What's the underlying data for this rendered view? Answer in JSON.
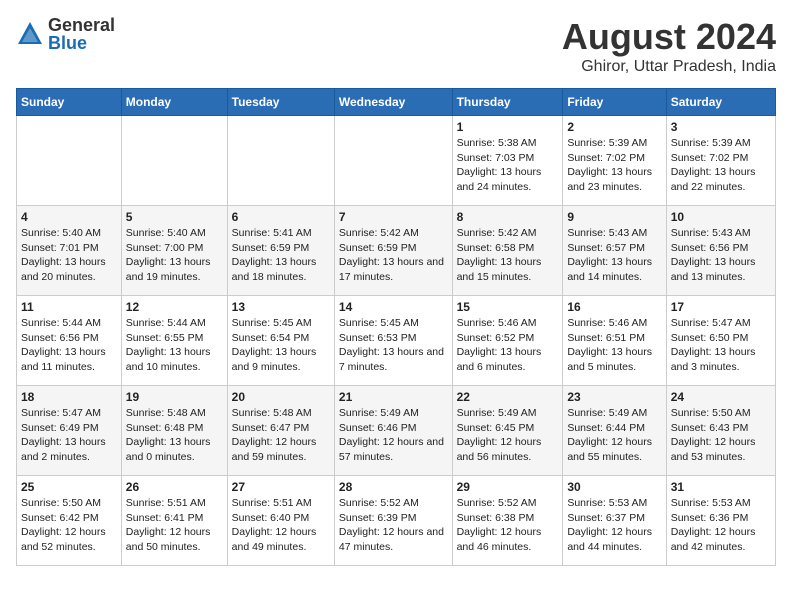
{
  "logo": {
    "general": "General",
    "blue": "Blue"
  },
  "title": "August 2024",
  "subtitle": "Ghiror, Uttar Pradesh, India",
  "days_of_week": [
    "Sunday",
    "Monday",
    "Tuesday",
    "Wednesday",
    "Thursday",
    "Friday",
    "Saturday"
  ],
  "weeks": [
    [
      {
        "day": "",
        "info": ""
      },
      {
        "day": "",
        "info": ""
      },
      {
        "day": "",
        "info": ""
      },
      {
        "day": "",
        "info": ""
      },
      {
        "day": "1",
        "info": "Sunrise: 5:38 AM\nSunset: 7:03 PM\nDaylight: 13 hours and 24 minutes."
      },
      {
        "day": "2",
        "info": "Sunrise: 5:39 AM\nSunset: 7:02 PM\nDaylight: 13 hours and 23 minutes."
      },
      {
        "day": "3",
        "info": "Sunrise: 5:39 AM\nSunset: 7:02 PM\nDaylight: 13 hours and 22 minutes."
      }
    ],
    [
      {
        "day": "4",
        "info": "Sunrise: 5:40 AM\nSunset: 7:01 PM\nDaylight: 13 hours and 20 minutes."
      },
      {
        "day": "5",
        "info": "Sunrise: 5:40 AM\nSunset: 7:00 PM\nDaylight: 13 hours and 19 minutes."
      },
      {
        "day": "6",
        "info": "Sunrise: 5:41 AM\nSunset: 6:59 PM\nDaylight: 13 hours and 18 minutes."
      },
      {
        "day": "7",
        "info": "Sunrise: 5:42 AM\nSunset: 6:59 PM\nDaylight: 13 hours and 17 minutes."
      },
      {
        "day": "8",
        "info": "Sunrise: 5:42 AM\nSunset: 6:58 PM\nDaylight: 13 hours and 15 minutes."
      },
      {
        "day": "9",
        "info": "Sunrise: 5:43 AM\nSunset: 6:57 PM\nDaylight: 13 hours and 14 minutes."
      },
      {
        "day": "10",
        "info": "Sunrise: 5:43 AM\nSunset: 6:56 PM\nDaylight: 13 hours and 13 minutes."
      }
    ],
    [
      {
        "day": "11",
        "info": "Sunrise: 5:44 AM\nSunset: 6:56 PM\nDaylight: 13 hours and 11 minutes."
      },
      {
        "day": "12",
        "info": "Sunrise: 5:44 AM\nSunset: 6:55 PM\nDaylight: 13 hours and 10 minutes."
      },
      {
        "day": "13",
        "info": "Sunrise: 5:45 AM\nSunset: 6:54 PM\nDaylight: 13 hours and 9 minutes."
      },
      {
        "day": "14",
        "info": "Sunrise: 5:45 AM\nSunset: 6:53 PM\nDaylight: 13 hours and 7 minutes."
      },
      {
        "day": "15",
        "info": "Sunrise: 5:46 AM\nSunset: 6:52 PM\nDaylight: 13 hours and 6 minutes."
      },
      {
        "day": "16",
        "info": "Sunrise: 5:46 AM\nSunset: 6:51 PM\nDaylight: 13 hours and 5 minutes."
      },
      {
        "day": "17",
        "info": "Sunrise: 5:47 AM\nSunset: 6:50 PM\nDaylight: 13 hours and 3 minutes."
      }
    ],
    [
      {
        "day": "18",
        "info": "Sunrise: 5:47 AM\nSunset: 6:49 PM\nDaylight: 13 hours and 2 minutes."
      },
      {
        "day": "19",
        "info": "Sunrise: 5:48 AM\nSunset: 6:48 PM\nDaylight: 13 hours and 0 minutes."
      },
      {
        "day": "20",
        "info": "Sunrise: 5:48 AM\nSunset: 6:47 PM\nDaylight: 12 hours and 59 minutes."
      },
      {
        "day": "21",
        "info": "Sunrise: 5:49 AM\nSunset: 6:46 PM\nDaylight: 12 hours and 57 minutes."
      },
      {
        "day": "22",
        "info": "Sunrise: 5:49 AM\nSunset: 6:45 PM\nDaylight: 12 hours and 56 minutes."
      },
      {
        "day": "23",
        "info": "Sunrise: 5:49 AM\nSunset: 6:44 PM\nDaylight: 12 hours and 55 minutes."
      },
      {
        "day": "24",
        "info": "Sunrise: 5:50 AM\nSunset: 6:43 PM\nDaylight: 12 hours and 53 minutes."
      }
    ],
    [
      {
        "day": "25",
        "info": "Sunrise: 5:50 AM\nSunset: 6:42 PM\nDaylight: 12 hours and 52 minutes."
      },
      {
        "day": "26",
        "info": "Sunrise: 5:51 AM\nSunset: 6:41 PM\nDaylight: 12 hours and 50 minutes."
      },
      {
        "day": "27",
        "info": "Sunrise: 5:51 AM\nSunset: 6:40 PM\nDaylight: 12 hours and 49 minutes."
      },
      {
        "day": "28",
        "info": "Sunrise: 5:52 AM\nSunset: 6:39 PM\nDaylight: 12 hours and 47 minutes."
      },
      {
        "day": "29",
        "info": "Sunrise: 5:52 AM\nSunset: 6:38 PM\nDaylight: 12 hours and 46 minutes."
      },
      {
        "day": "30",
        "info": "Sunrise: 5:53 AM\nSunset: 6:37 PM\nDaylight: 12 hours and 44 minutes."
      },
      {
        "day": "31",
        "info": "Sunrise: 5:53 AM\nSunset: 6:36 PM\nDaylight: 12 hours and 42 minutes."
      }
    ]
  ]
}
